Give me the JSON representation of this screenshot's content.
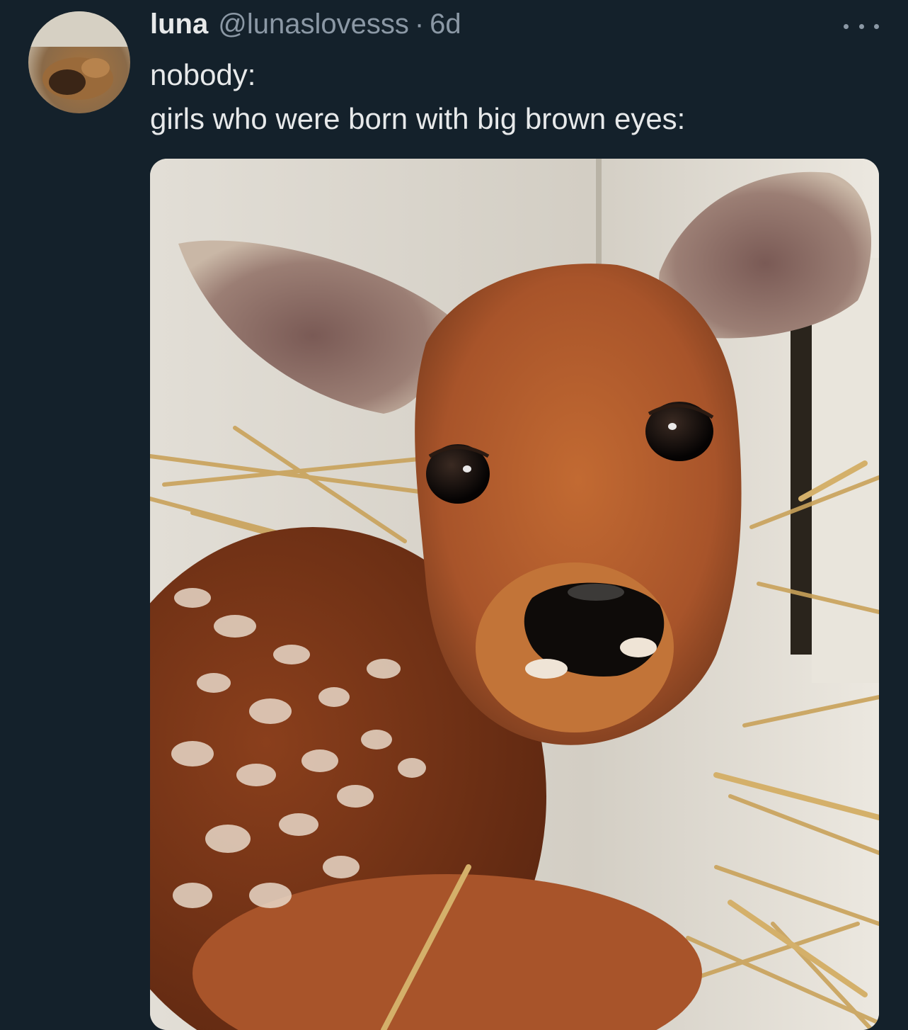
{
  "tweet": {
    "display_name": "luna",
    "handle": "@lunaslovesss",
    "separator": "·",
    "time": "6d",
    "text_line_1": "nobody:",
    "text_line_2": "girls who were born with big brown eyes:"
  },
  "icons": {
    "more": "more-horizontal-icon"
  },
  "colors": {
    "background": "#14212b",
    "primary_text": "#e7e9ea",
    "secondary_text": "#8b98a5"
  }
}
